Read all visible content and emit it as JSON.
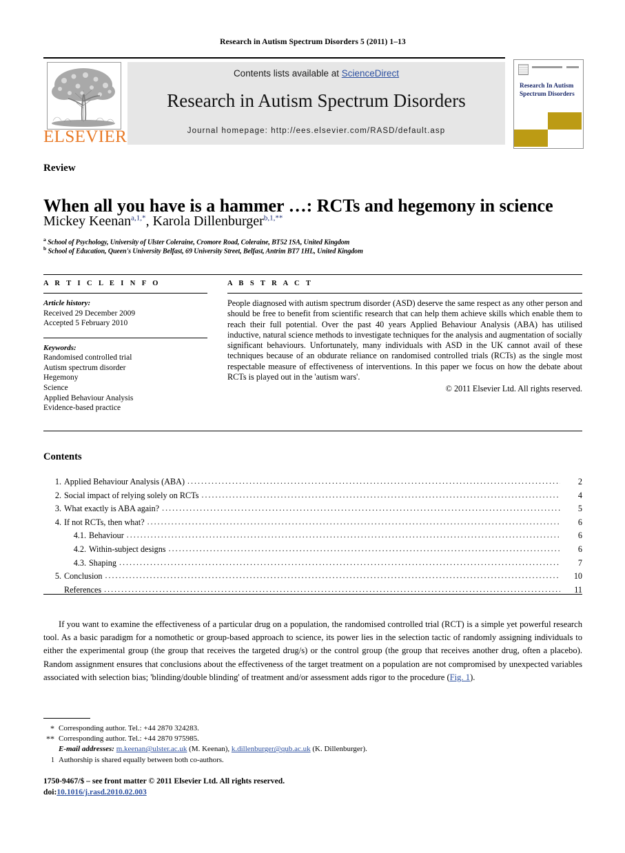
{
  "running_head": "Research in Autism Spectrum Disorders 5 (2011) 1–13",
  "masthead": {
    "contents_prefix": "Contents lists available at ",
    "sciencedirect": "ScienceDirect",
    "journal_title": "Research in Autism Spectrum Disorders",
    "homepage": "Journal homepage: http://ees.elsevier.com/RASD/default.asp",
    "publisher_wordmark": "ELSEVIER",
    "publisher_color": "#E87722",
    "link_color": "#2b4fa0"
  },
  "cover": {
    "title": "Research In Autism Spectrum Disorders",
    "accent_color": "#BC9B14"
  },
  "article": {
    "type_label": "Review",
    "title": "When all you have is a hammer …: RCTs and hegemony in science",
    "authors_html": "Mickey Keenan<sup>a,1,*</sup>, Karola Dillenburger<sup>b,1,**</sup>",
    "affiliation_a": "School of Psychology, University of Ulster Coleraine, Cromore Road, Coleraine, BT52 1SA, United Kingdom",
    "affiliation_b": "School of Education, Queen's University Belfast, 69 University Street, Belfast, Antrim BT7 1HL, United Kingdom"
  },
  "info": {
    "heading": "A R T I C L E   I N F O",
    "history_label": "Article history:",
    "history": [
      "Received 29 December 2009",
      "Accepted 5 February 2010"
    ],
    "keywords_label": "Keywords:",
    "keywords": [
      "Randomised controlled trial",
      "Autism spectrum disorder",
      "Hegemony",
      "Science",
      "Applied Behaviour Analysis",
      "Evidence-based practice"
    ]
  },
  "abstract": {
    "heading": "A B S T R A C T",
    "text": "People diagnosed with autism spectrum disorder (ASD) deserve the same respect as any other person and should be free to benefit from scientific research that can help them achieve skills which enable them to reach their full potential. Over the past 40 years Applied Behaviour Analysis (ABA) has utilised inductive, natural science methods to investigate techniques for the analysis and augmentation of socially significant behaviours. Unfortunately, many individuals with ASD in the UK cannot avail of these techniques because of an obdurate reliance on randomised controlled trials (RCTs) as the single most respectable measure of effectiveness of interventions. In this paper we focus on how the debate about RCTs is played out in the 'autism wars'.",
    "copyright": "© 2011 Elsevier Ltd. All rights reserved."
  },
  "contents": {
    "heading": "Contents",
    "items": [
      {
        "num": "1.",
        "label": "Applied Behaviour Analysis (ABA)",
        "page": "2",
        "level": 1
      },
      {
        "num": "2.",
        "label": "Social impact of relying solely on RCTs",
        "page": "4",
        "level": 1
      },
      {
        "num": "3.",
        "label": "What exactly is ABA again?",
        "page": "5",
        "level": 1
      },
      {
        "num": "4.",
        "label": "If not RCTs, then what?",
        "page": "6",
        "level": 1
      },
      {
        "num": "4.1.",
        "label": "Behaviour",
        "page": "6",
        "level": 2
      },
      {
        "num": "4.2.",
        "label": "Within-subject designs",
        "page": "6",
        "level": 2
      },
      {
        "num": "4.3.",
        "label": "Shaping",
        "page": "7",
        "level": 2
      },
      {
        "num": "5.",
        "label": "Conclusion",
        "page": "10",
        "level": 1
      },
      {
        "num": "",
        "label": "References",
        "page": "11",
        "level": 1
      }
    ]
  },
  "body": {
    "paragraph_1a": "If you want to examine the effectiveness of a particular drug on a population, the randomised controlled trial (RCT) is a simple yet powerful research tool. As a basic paradigm for a nomothetic or group-based approach to science, its power lies in the selection tactic of randomly assigning individuals to either the experimental group (the group that receives the targeted drug/s) or the control group (the group that receives another drug, often a placebo). Random assignment ensures that conclusions about the effectiveness of the target treatment on a population are not compromised by unexpected variables associated with selection bias; 'blinding/double blinding' of treatment and/or assessment adds rigor to the procedure (",
    "paragraph_1_xref": "Fig. 1",
    "paragraph_1b": ")."
  },
  "footnotes": {
    "star_mark": "*",
    "star_text": "Corresponding author. Tel.: +44 2870 324283.",
    "dstar_mark": "**",
    "dstar_text": "Corresponding author. Tel.: +44 2870 975985.",
    "emails_label": "E-mail addresses:",
    "email_1": "m.keenan@ulster.ac.uk",
    "email_1_owner": " (M. Keenan), ",
    "email_2": "k.dillenburger@qub.ac.uk",
    "email_2_owner": " (K. Dillenburger).",
    "one_mark": "1",
    "one_text": "Authorship is shared equally between both co-authors."
  },
  "colophon": {
    "line1": "1750-9467/$ – see front matter © 2011 Elsevier Ltd. All rights reserved.",
    "doi_label": "doi:",
    "doi": "10.1016/j.rasd.2010.02.003"
  }
}
